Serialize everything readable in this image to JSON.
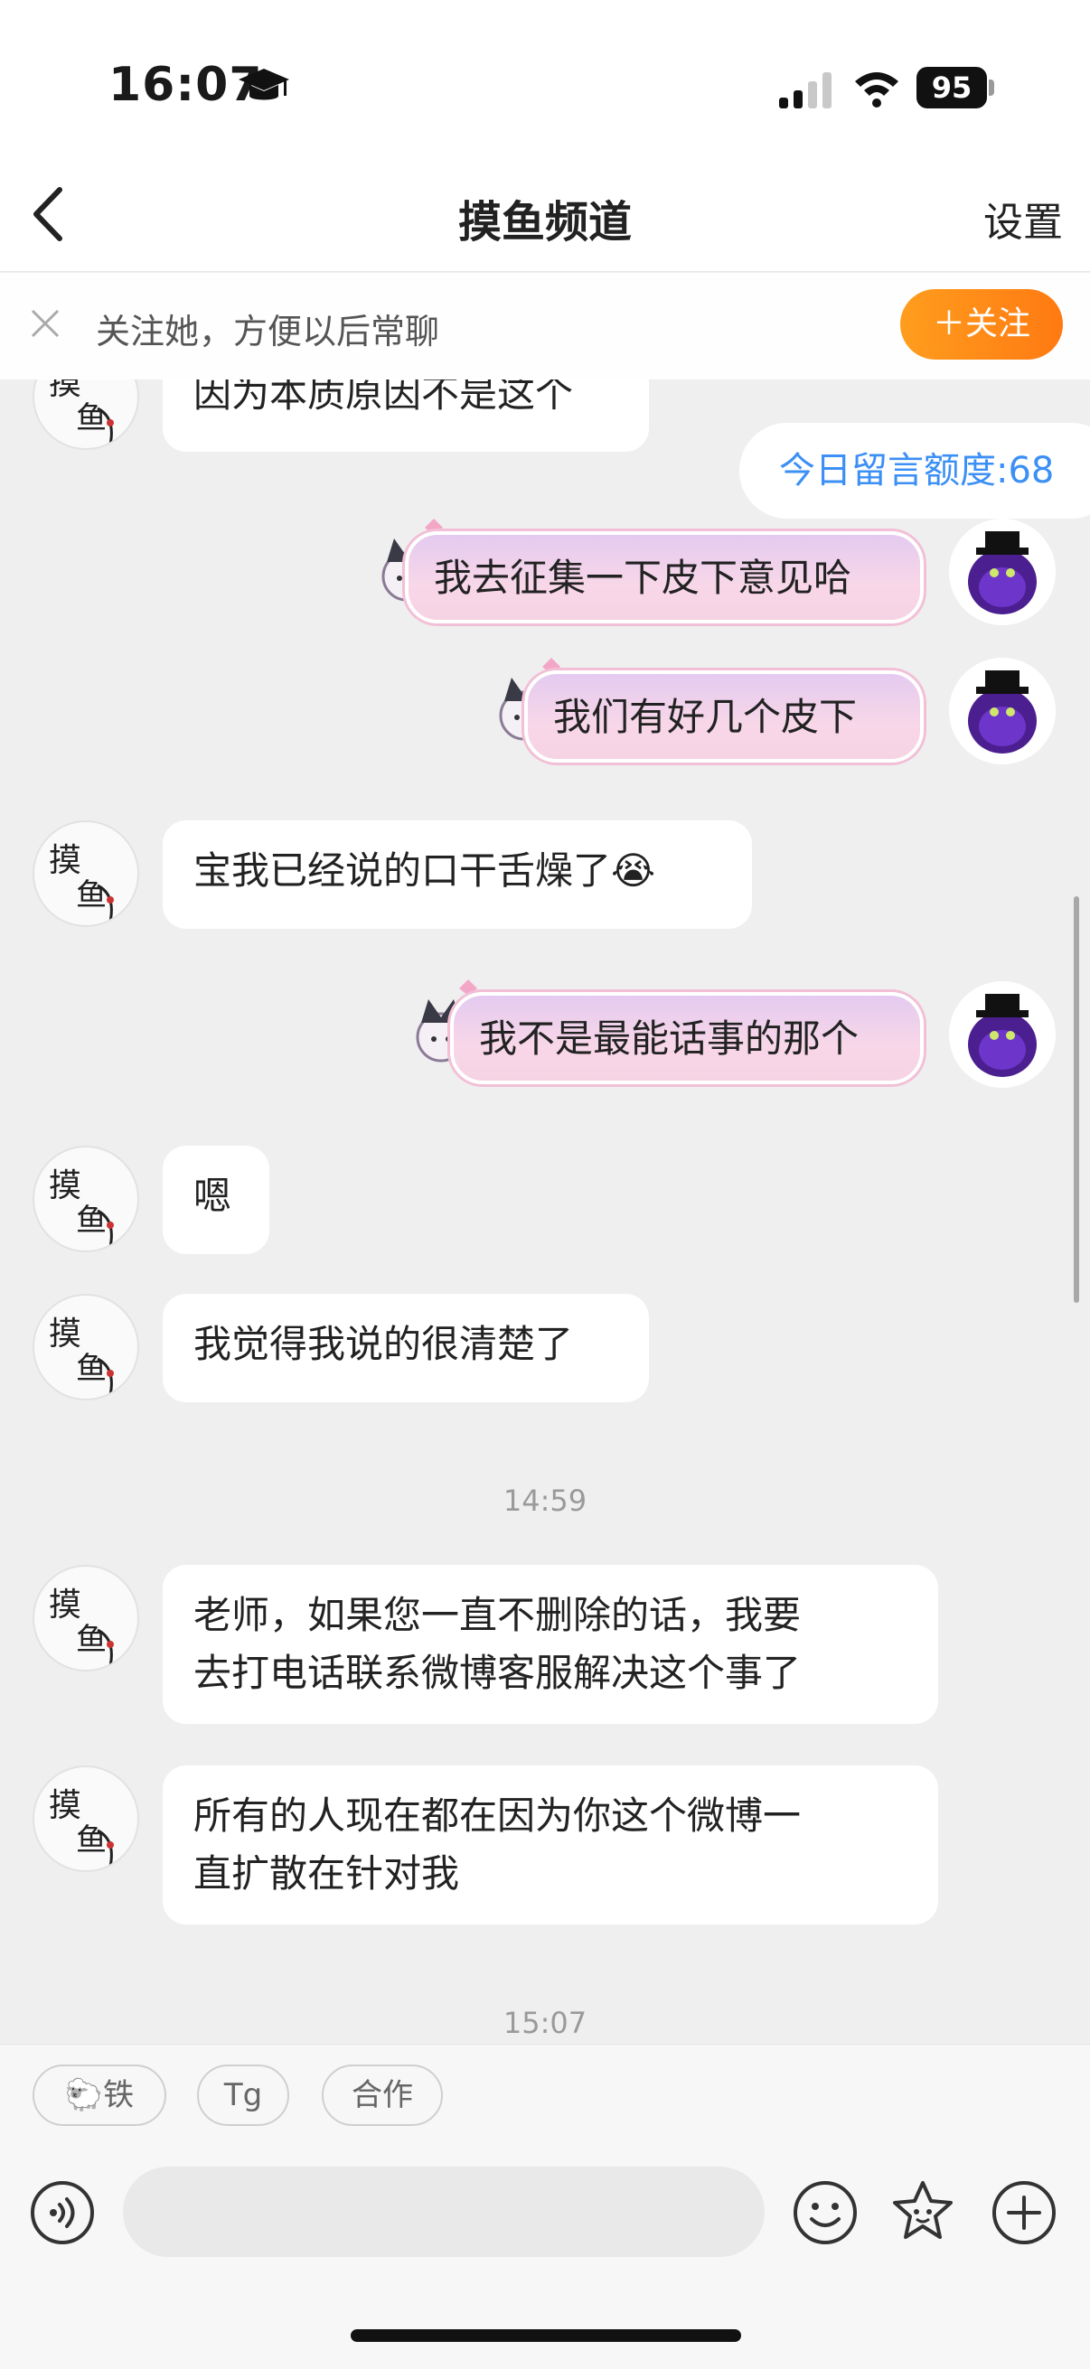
{
  "status": {
    "time": "16:07",
    "battery": "95"
  },
  "nav": {
    "title": "摸鱼频道",
    "settings": "设置"
  },
  "follow": {
    "text": "关注她，方便以后常聊",
    "button": "＋关注"
  },
  "quota": "今日留言额度:68",
  "messages": [
    {
      "side": "left",
      "text": "因为本质原因不是这个"
    },
    {
      "side": "right",
      "text": "我去征集一下皮下意见哈"
    },
    {
      "side": "right",
      "text": "我们有好几个皮下"
    },
    {
      "side": "left",
      "text": "宝我已经说的口干舌燥了😭"
    },
    {
      "side": "right",
      "text": "我不是最能话事的那个"
    },
    {
      "side": "left",
      "text": "嗯"
    },
    {
      "side": "left",
      "text": "我觉得我说的很清楚了"
    },
    {
      "side": "left",
      "text": "老师，如果您一直不删除的话，我要\n去打电话联系微博客服解决这个事了"
    },
    {
      "side": "left",
      "text": "所有的人现在都在因为你这个微博一\n直扩散在针对我"
    }
  ],
  "timestamps": [
    "14:59",
    "15:07"
  ],
  "quick_replies": [
    "🐑铁",
    "Tg",
    "合作"
  ],
  "input": {
    "placeholder": ""
  },
  "colors": {
    "accent": "#ff8a18",
    "link": "#3b8ff5"
  }
}
